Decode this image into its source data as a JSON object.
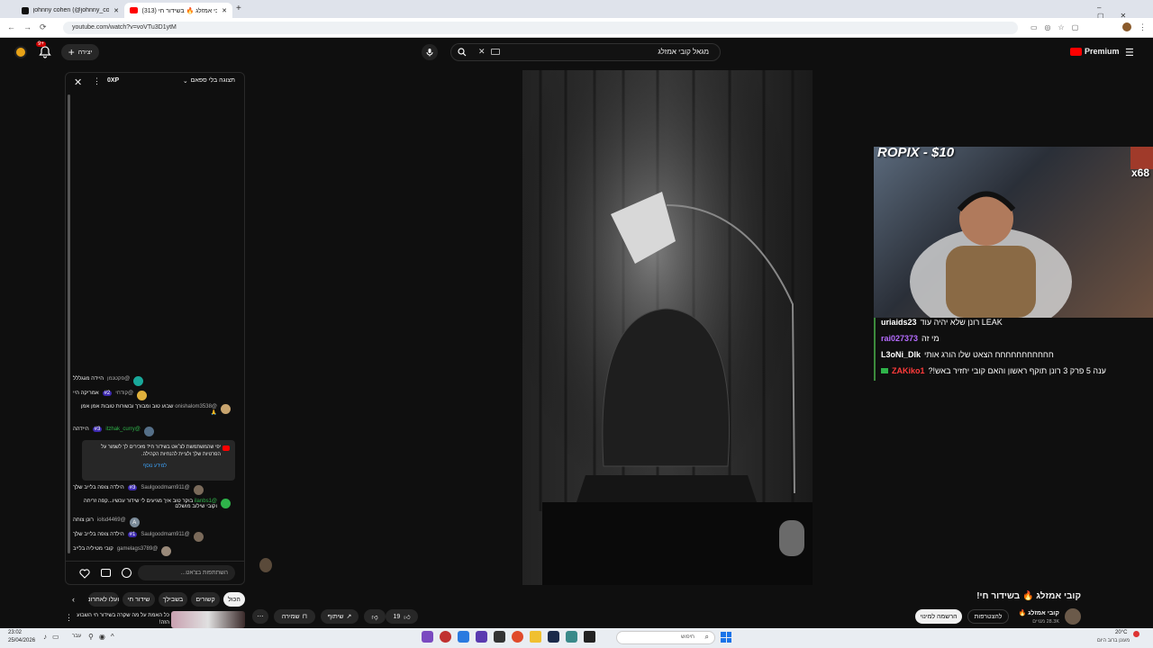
{
  "browser": {
    "tabs": [
      {
        "label": "johnny cohen (@johnny_cohen..."
      },
      {
        "label": "(313) קובי אמזלג 🔥 בשידור חי!"
      }
    ],
    "url": "youtube.com/watch?v=voVTu3D1ytM"
  },
  "header": {
    "search_value": "מגאל קובי אמזלג",
    "create_label": "יצירה",
    "notif_count": "9+",
    "premium_label": "Premium"
  },
  "chat": {
    "mode_label": "תצוגה בלי ספאם",
    "xp_label": "0XP",
    "messages": [
      {
        "user": "@פקטנמן",
        "text": "היידה מגגללל",
        "color": "#19a89a"
      },
      {
        "user": "@קודחי",
        "badge": "#2",
        "text": "אמריקה היי",
        "color": "#e0b13c"
      },
      {
        "user": "@onishalom3538",
        "text": "שבוע טוב ומבורך ובשורות טובות אמן אמן 🙏",
        "color": "#c8a46e"
      },
      {
        "user": "@itzhak_curry",
        "badge": "#3",
        "text": "היידהה",
        "color": "#556f88"
      },
      {
        "user": "@Saulgoodmam911",
        "badge": "#3",
        "text": "הילדה צופה בלייב שלך",
        "color": "#7a6a5a"
      },
      {
        "user": "@ilanbs1",
        "text": "בוקר טוב איך מגיעים לי שידור עכשיו...קפה זריחה וקובי שילוב מושלם",
        "color": "#2fb34a"
      },
      {
        "user": "@iolsd4469",
        "text": "רונן צוחה",
        "color": "#7b8b99"
      },
      {
        "user": "@Saulgoodmam911",
        "badge": "#1",
        "text": "הילדה צופה בלייב שלך",
        "color": "#7a6a5a"
      },
      {
        "user": "@gamelags3789",
        "text": "קובי מטיליה בלייב",
        "color": "#9a8a7a"
      }
    ],
    "notice": {
      "text": "יפי שהמשתמשת לצ׳אט בשידור חי? מזכירים לך לשמור על הפרטיות שלך ולציית להנחיות הקהילה.",
      "link": "למידע נוסף"
    },
    "input_placeholder": "השתתפות בצ'אט...",
    "avatar_initial": "A"
  },
  "overlay": {
    "donation": "ROPIX - $10",
    "corner_tag": "x68",
    "lines": [
      {
        "user": "uriaids23",
        "text": "רונן שלא יהיה עוד LEAK",
        "color": "#ffffff"
      },
      {
        "user": "rai027373",
        "text": "מי זה",
        "color": "#b66cff"
      },
      {
        "user": "L3oNi_Dlk",
        "text": "חחחחחחחחחחח הצאט שלו הורג אותי",
        "color": "#ffffff"
      },
      {
        "user": "ZAKiko1",
        "text": "?!ענה 5 פרק 3 רונן תוקף ראשון והאם קובי יחזיר באש",
        "color": "#ff3b3b"
      }
    ]
  },
  "video_info": {
    "title": "קובי אמזלג 🔥 בשידור חי!",
    "channel": "קובי אמזלג 🔥",
    "subs": "28.3K מנויים",
    "join_label": "להצטרפות",
    "subscribe_label": "הרשמה למינוי",
    "likes": "19",
    "share_label": "שיתוף",
    "save_label": "שמירה",
    "chips": [
      "הכול",
      "קשורים",
      "בשבילך",
      "שידור חי",
      "הועלו לאחרונה"
    ],
    "rec_title": "כל האמת על מה שקרה בשידור חי השבוע הזה!"
  },
  "taskbar": {
    "time": "23:02",
    "date": "25/04/2026",
    "lang": "עבר",
    "search": "חיפוש",
    "weather_temp": "20°C",
    "weather_desc": "מעונן ברוב היום"
  },
  "colors": {
    "yt_red": "#ff0000",
    "accent": "#3ea6ff",
    "badge": "#3d2ab0"
  }
}
